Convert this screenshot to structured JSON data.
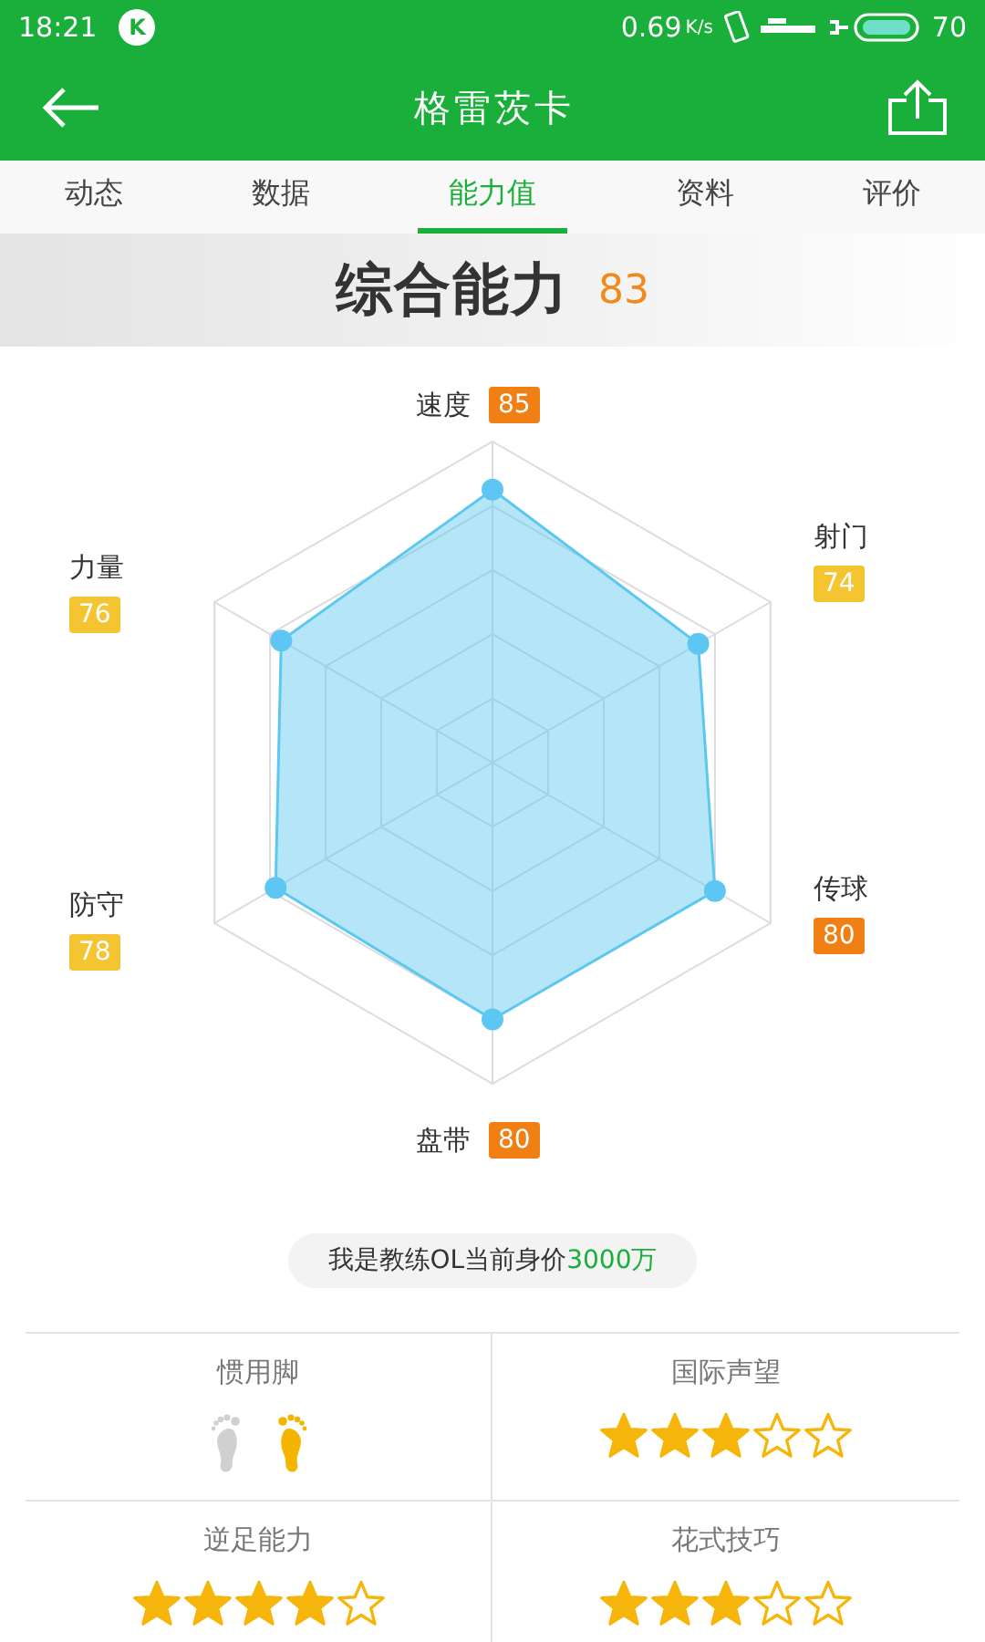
{
  "status_bar": {
    "time": "18:21",
    "app_badge": "K",
    "speed": "0.69",
    "speed_unit": "K/s",
    "battery": "70"
  },
  "header": {
    "title": "格雷茨卡"
  },
  "tabs": [
    {
      "label": "动态",
      "selected": false
    },
    {
      "label": "数据",
      "selected": false
    },
    {
      "label": "能力值",
      "selected": true
    },
    {
      "label": "资料",
      "selected": false
    },
    {
      "label": "评价",
      "selected": false
    }
  ],
  "overall": {
    "label": "综合能力",
    "value": "83"
  },
  "radar": [
    {
      "name": "速度",
      "value": "85",
      "color": "#f07f14"
    },
    {
      "name": "射门",
      "value": "74",
      "color": "#f5c431"
    },
    {
      "name": "传球",
      "value": "80",
      "color": "#f07f14"
    },
    {
      "name": "盘带",
      "value": "80",
      "color": "#f07f14"
    },
    {
      "name": "防守",
      "value": "78",
      "color": "#f5c431"
    },
    {
      "name": "力量",
      "value": "76",
      "color": "#f5c431"
    }
  ],
  "value_chip": {
    "text": "我是教练OL当前身价",
    "amount": "3000万"
  },
  "traits": [
    {
      "kind": "feet",
      "label": "惯用脚",
      "feet": [
        {
          "selected": false
        },
        {
          "selected": true
        }
      ]
    },
    {
      "kind": "stars",
      "label": "国际声望",
      "stars": 3
    },
    {
      "kind": "stars",
      "label": "逆足能力",
      "stars": 4
    },
    {
      "kind": "stars",
      "label": "花式技巧",
      "stars": 3
    }
  ]
}
